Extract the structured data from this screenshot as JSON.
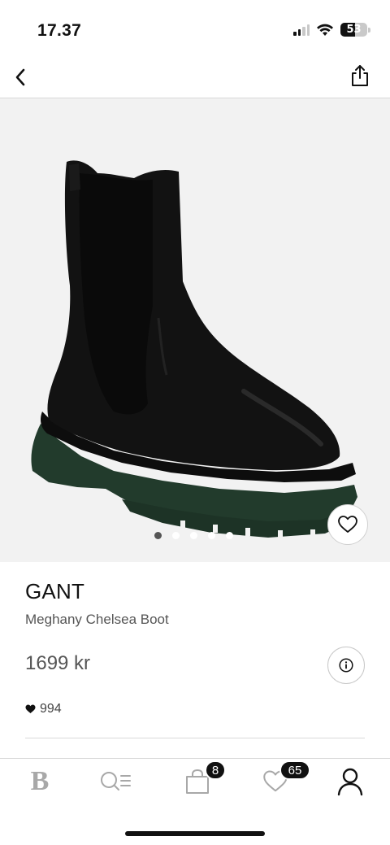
{
  "status_bar": {
    "time": "17.37",
    "battery_level": "53",
    "signal_bars_active": 2,
    "signal_bars_total": 4,
    "icons": [
      "signal-icon",
      "wifi-icon",
      "battery-icon"
    ]
  },
  "top_nav": {
    "back_icon": "chevron-left-icon",
    "share_icon": "share-icon"
  },
  "gallery": {
    "image_subject": "black leather chelsea boot with green sole",
    "dot_count": 5,
    "active_dot": 0,
    "favorite_icon": "heart-outline-icon"
  },
  "product": {
    "brand": "GANT",
    "name": "Meghany Chelsea Boot",
    "price": "1699 kr",
    "likes": "994",
    "info_icon": "info-icon"
  },
  "tab_bar": {
    "items": [
      {
        "name": "home",
        "icon": "brand-logo-icon",
        "label": "B"
      },
      {
        "name": "search",
        "icon": "search-icon"
      },
      {
        "name": "bag",
        "icon": "shopping-bag-icon",
        "badge": "8"
      },
      {
        "name": "favorites",
        "icon": "heart-icon",
        "badge": "65"
      },
      {
        "name": "profile",
        "icon": "profile-icon"
      }
    ]
  },
  "colors": {
    "background": "#ffffff",
    "gallery_background": "#f2f2f2",
    "text_primary": "#111111",
    "text_secondary": "#555555",
    "badge": "#111111"
  }
}
